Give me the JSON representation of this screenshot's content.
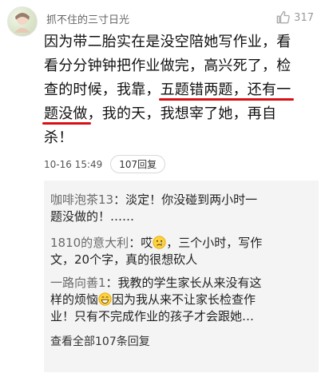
{
  "post": {
    "username": "抓不住的三寸日光",
    "like_count": "317",
    "comment_lines": [
      {
        "pre": "因为带二胎实在是没空陪她写作业，看"
      },
      {
        "pre": "看分分钟钟把作业做完，高兴死了，检"
      },
      {
        "pre": "查的时候，我靠，",
        "u": "五题错两题，还有一",
        "post": ""
      },
      {
        "pre": "",
        "u": "题没做",
        "post": "，我的天，我想宰了她，再自"
      },
      {
        "pre": "杀！"
      }
    ],
    "timestamp": "10-16 15:49",
    "reply_count_label": "107回复"
  },
  "replies": [
    {
      "name": "咖啡泡茶13",
      "text_lines": [
        "：淡定！你没碰到两小时一",
        "题没做的！……"
      ]
    },
    {
      "name": "1810的意大利",
      "text_a": "：哎",
      "emoji": "sad-face-emoji",
      "text_b": "，三个小时，写作",
      "text_lines": [
        "文，20个字，真的很想砍人"
      ]
    },
    {
      "name": "一路向善1",
      "text_a": "：我教的学生家长从来没有这",
      "line2_a": "样的烦恼",
      "emoji": "grin-face-emoji",
      "line2_b": "因为我从来不让家长检查作",
      "text_lines": [
        "业！只有不完成作业的孩子才会跟她…"
      ]
    }
  ],
  "view_all": "查看全部107条回复"
}
